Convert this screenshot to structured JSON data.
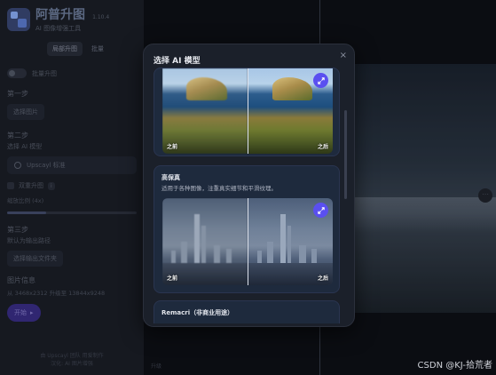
{
  "sidebar": {
    "app_title": "阿普升图",
    "version": "1.10.4",
    "subtitle": "AI 图像增强工具",
    "mode_tabs": [
      "局部升图",
      "批量"
    ],
    "toggle_label": "批量升图",
    "step1_title": "第一步",
    "step1_button": "选择图片",
    "step2_title": "第二步",
    "step2_sub": "选择 AI 模型",
    "model_selected": "Upscayl 标准",
    "double_upscale_label": "双重升图",
    "scale_label": "缩放比例 (4x)",
    "step3_title": "第三步",
    "step3_sub": "默认为输出路径",
    "step3_button": "选择输出文件夹",
    "info_title": "图片信息",
    "info_line": "从 3468x2312 升级至 13844x9248",
    "start_button": "开始",
    "footer_line1": "由 Upscayl 团队 用爱制作",
    "footer_line2": "汉化: AI 图片增强"
  },
  "main": {
    "bottom_label": "升级",
    "watermark": "CSDN @KJ-拾荒者"
  },
  "modal": {
    "title": "选择 AI 模型",
    "close_icon": "×",
    "cards": [
      {
        "title": "",
        "desc": "",
        "before_tag": "之前",
        "after_tag": "之后"
      },
      {
        "title": "高保真",
        "desc": "适用于各种图像，注重真实细节和平滑纹理。",
        "before_tag": "之前",
        "after_tag": "之后"
      },
      {
        "title": "Remacri（非商业用途）",
        "desc": ""
      }
    ]
  }
}
